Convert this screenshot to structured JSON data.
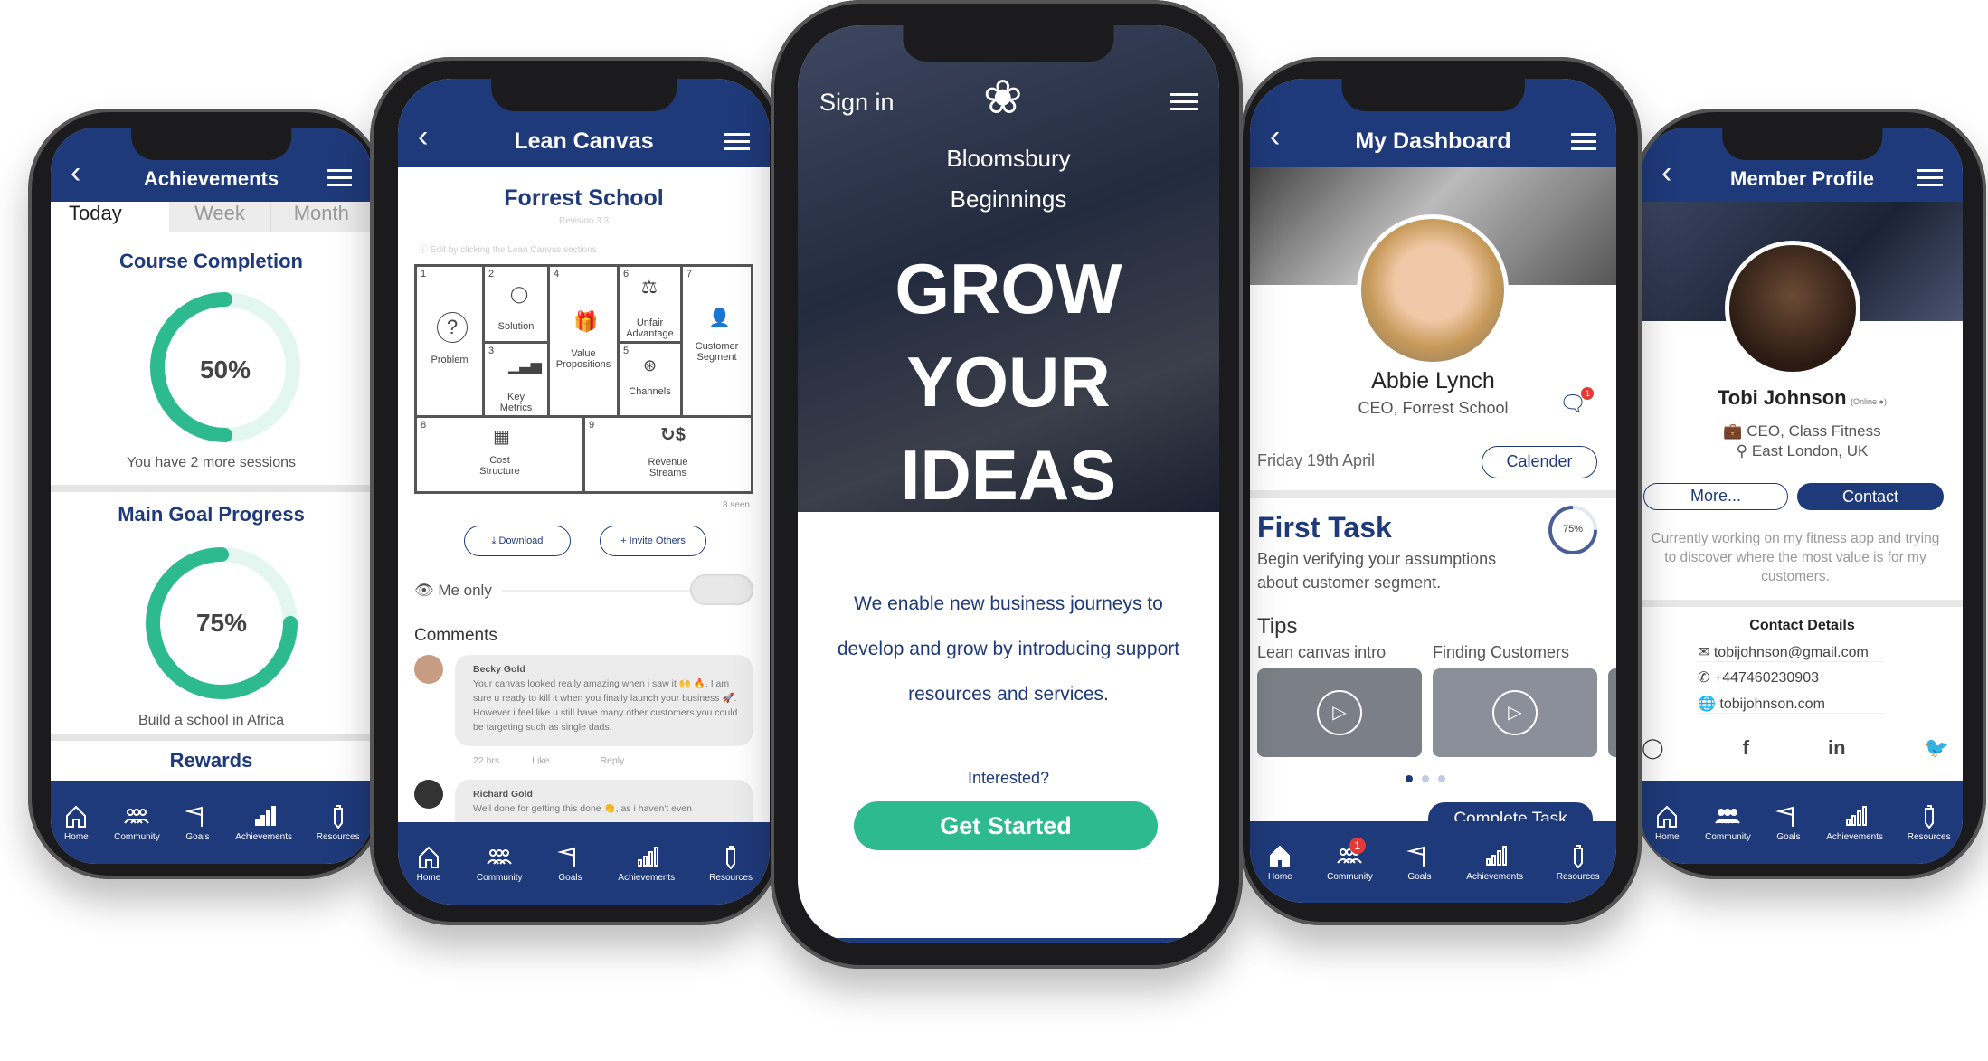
{
  "nav": [
    "Home",
    "Community",
    "Goals",
    "Achievements",
    "Resources"
  ],
  "achievements": {
    "title": "Achievements",
    "tabs": [
      "Today",
      "Week",
      "Month"
    ],
    "course_title": "Course Completion",
    "course_pct": "50%",
    "course_value": 0.5,
    "course_note": "You have 2 more sessions",
    "goal_title": "Main Goal Progress",
    "goal_pct": "75%",
    "goal_value": 0.75,
    "goal_note": "Build a school in Africa",
    "rewards": "Rewards",
    "accent": "#2dba8e"
  },
  "canvas": {
    "title": "Lean Canvas",
    "project": "Forrest School",
    "revision": "Revision 3.3",
    "hint": "Edit by clicking the Lean Canvas sections",
    "cells": [
      {
        "n": "1",
        "label": "Problem"
      },
      {
        "n": "2",
        "label": "Solution"
      },
      {
        "n": "3",
        "label": "Key Metrics"
      },
      {
        "n": "4",
        "label": "Value Propositions"
      },
      {
        "n": "6",
        "label": "Unfair Advantage"
      },
      {
        "n": "5",
        "label": "Channels"
      },
      {
        "n": "7",
        "label": "Customer Segment"
      },
      {
        "n": "8",
        "label": "Cost Structure"
      },
      {
        "n": "9",
        "label": "Revenue Streams"
      }
    ],
    "seen": "8 seen",
    "download": "Download",
    "invite": "Invite Others",
    "visibility": "Me only",
    "comments_title": "Comments",
    "comments": [
      {
        "name": "Becky Gold",
        "text": "Your canvas looked really amazing when i saw it 🙌 🔥. I am sure u ready to kill it when you finally launch your business 🚀. However i feel like u still have many other customers you could be targeting such as single dads.",
        "time": "22 hrs",
        "like": "Like",
        "reply": "Reply"
      },
      {
        "name": "Richard Gold",
        "text": "Well done for getting this done 👏, as i haven't even"
      }
    ]
  },
  "signin": {
    "sign_in": "Sign in",
    "brand": "Bloomsbury Beginnings",
    "headline": [
      "GROW",
      "YOUR",
      "IDEAS"
    ],
    "tagline": "We enable new business journeys to develop and grow by introducing support resources and services.",
    "question": "Interested?",
    "cta": "Get Started",
    "cta_color": "#2dba8e"
  },
  "dashboard": {
    "title": "My Dashboard",
    "name": "Abbie Lynch",
    "role": "CEO, Forrest School",
    "date": "Friday 19th April",
    "calendar": "Calender",
    "msg_badge": "1",
    "task_title": "First Task",
    "task_text": "Begin verifying your assumptions about customer segment.",
    "task_pct": "75%",
    "task_value": 0.75,
    "tips_title": "Tips",
    "tips": [
      "Lean canvas intro",
      "Finding Customers"
    ],
    "complete": "Complete Task",
    "community_badge": "1"
  },
  "profile": {
    "title": "Member Profile",
    "name": "Tobi Johnson",
    "status": "(Online ●)",
    "role": "CEO, Class Fitness",
    "location": "East London, UK",
    "more": "More...",
    "contact": "Contact",
    "bio": "Currently working on my fitness app and trying to discover where the most value is for my customers.",
    "contact_title": "Contact Details",
    "email": "tobijohnson@gmail.com",
    "phone": "+447460230903",
    "website": "tobijohnson.com"
  }
}
